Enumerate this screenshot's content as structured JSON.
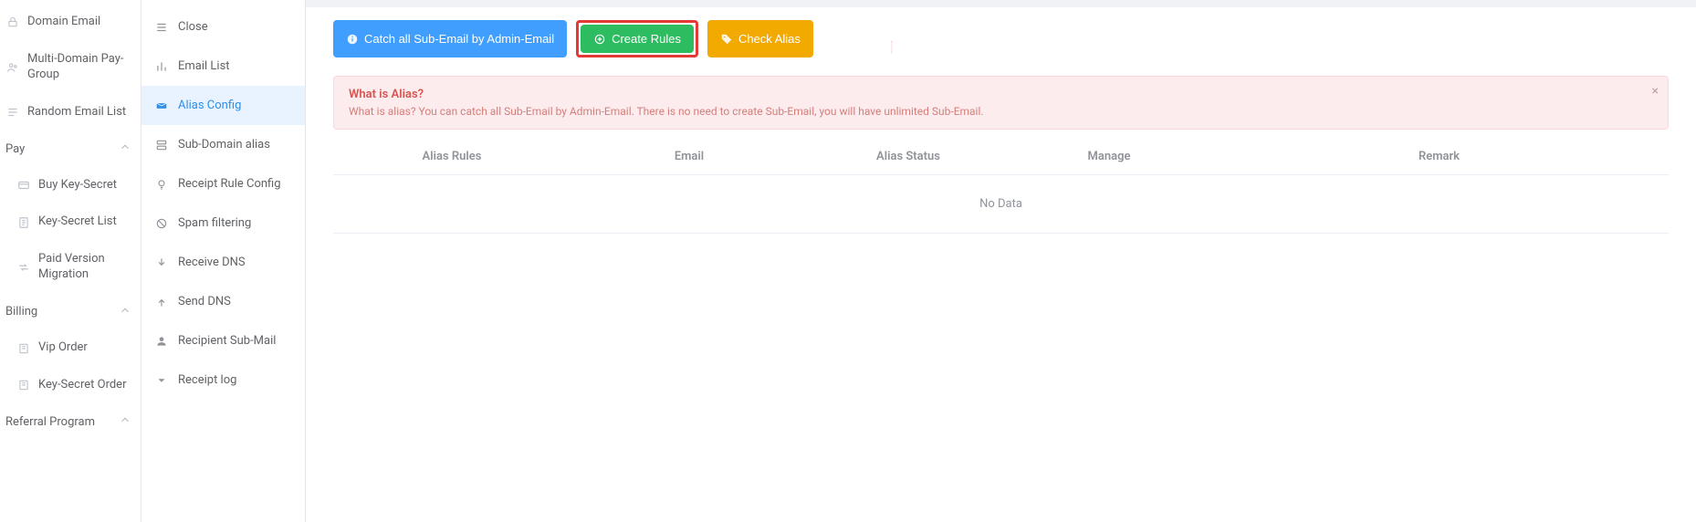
{
  "sidebar1": {
    "items": [
      {
        "label": "Domain Email",
        "icon": "lock-icon"
      },
      {
        "label": "Multi-Domain Pay-Group",
        "icon": "group-icon"
      },
      {
        "label": "Random Email List",
        "icon": "list-icon"
      }
    ],
    "groups": [
      {
        "label": "Pay",
        "children": [
          {
            "label": "Buy Key-Secret",
            "icon": "card-icon"
          },
          {
            "label": "Key-Secret List",
            "icon": "doc-icon"
          },
          {
            "label": "Paid Version Migration",
            "icon": "transfer-icon"
          }
        ]
      },
      {
        "label": "Billing",
        "children": [
          {
            "label": "Vip Order",
            "icon": "order-icon"
          },
          {
            "label": "Key-Secret Order",
            "icon": "order-icon"
          }
        ]
      },
      {
        "label": "Referral Program",
        "children": []
      }
    ]
  },
  "sidebar2": {
    "items": [
      {
        "label": "Close",
        "icon": "menu-icon",
        "active": false
      },
      {
        "label": "Email List",
        "icon": "chart-icon",
        "active": false
      },
      {
        "label": "Alias Config",
        "icon": "alias-icon",
        "active": true
      },
      {
        "label": "Sub-Domain alias",
        "icon": "subdomain-icon",
        "active": false
      },
      {
        "label": "Receipt Rule Config",
        "icon": "bulb-icon",
        "active": false
      },
      {
        "label": "Spam filtering",
        "icon": "spam-icon",
        "active": false
      },
      {
        "label": "Receive DNS",
        "icon": "down-icon",
        "active": false
      },
      {
        "label": "Send DNS",
        "icon": "up-icon",
        "active": false
      },
      {
        "label": "Recipient Sub-Mail",
        "icon": "user-icon",
        "active": false
      },
      {
        "label": "Receipt log",
        "icon": "log-icon",
        "active": false
      }
    ]
  },
  "toolbar": {
    "catch_all_label": "Catch all Sub-Email by Admin-Email",
    "create_rules_label": "Create Rules",
    "check_alias_label": "Check Alias"
  },
  "alert": {
    "title": "What is Alias?",
    "desc": "What is alias? You can catch all Sub-Email by Admin-Email. There is no need to create Sub-Email, you will have unlimited Sub-Email.",
    "close": "×"
  },
  "table": {
    "headers": {
      "alias_rules": "Alias Rules",
      "email": "Email",
      "alias_status": "Alias Status",
      "manage": "Manage",
      "remark": "Remark"
    },
    "no_data": "No Data"
  },
  "colors": {
    "highlight_red": "#e53935",
    "primary_blue": "#409eff",
    "success_green": "#2dbd60",
    "warning_orange": "#f2a900"
  }
}
